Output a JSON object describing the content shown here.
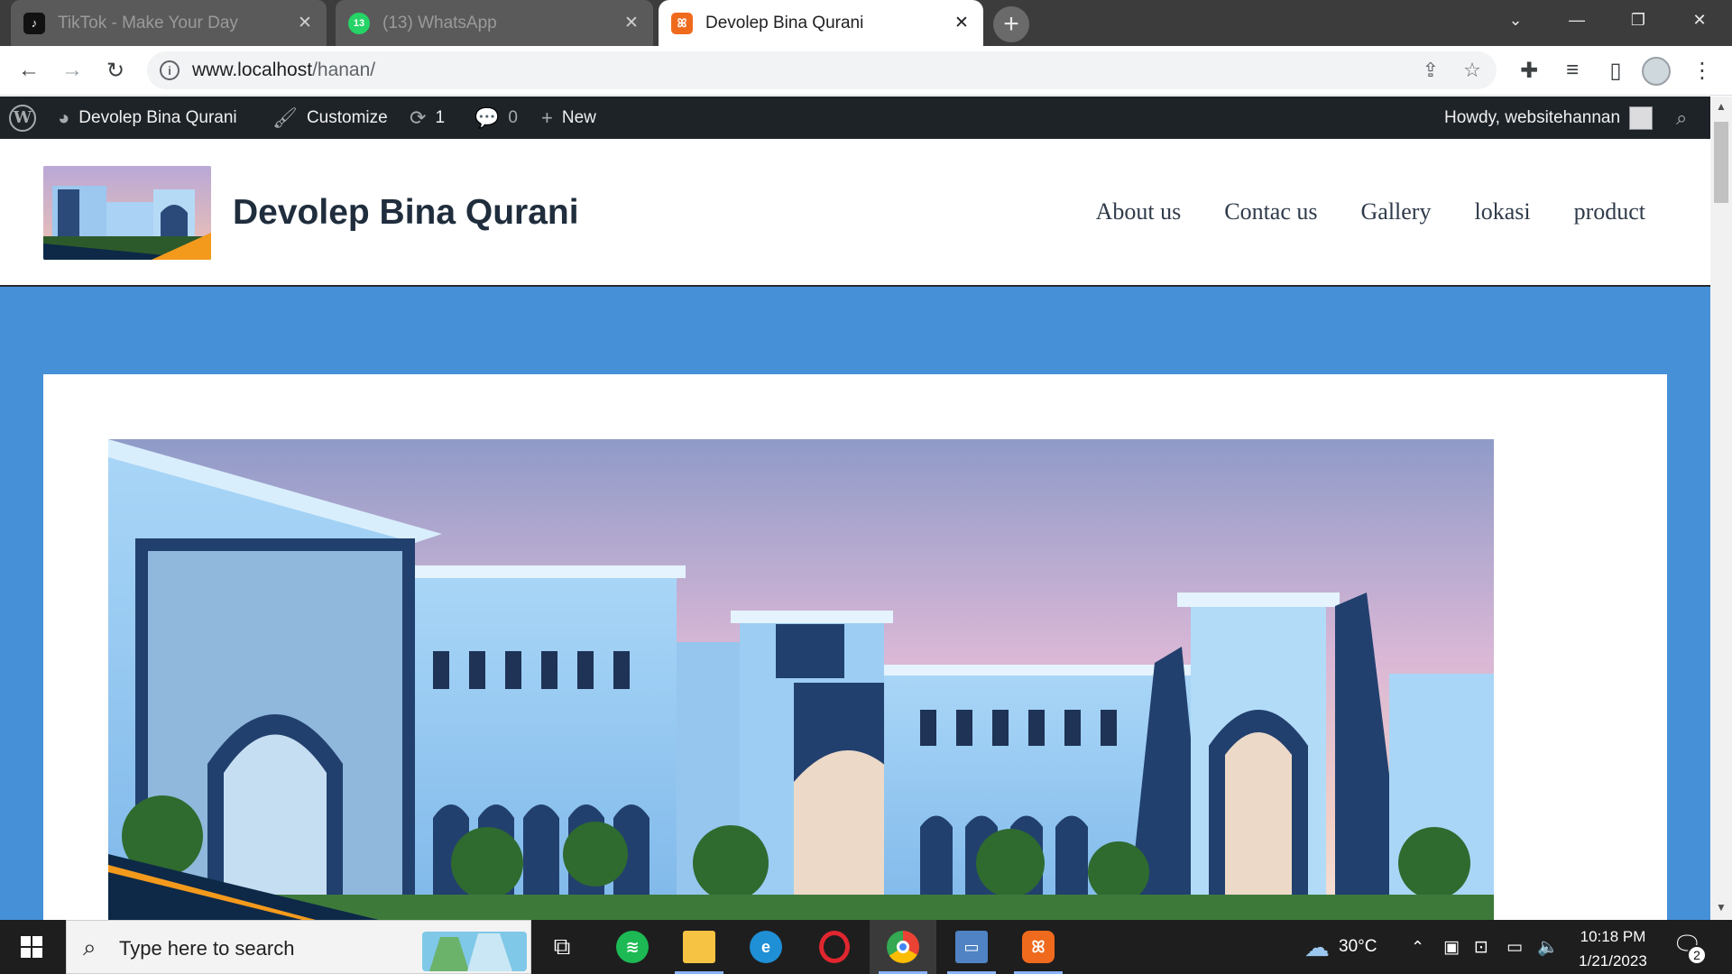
{
  "browser": {
    "tabs": [
      {
        "title": "TikTok - Make Your Day",
        "icon": "tiktok-icon",
        "active": false
      },
      {
        "title": "(13) WhatsApp",
        "icon": "whatsapp-icon",
        "badge": "13",
        "active": false
      },
      {
        "title": "Devolep Bina Qurani",
        "icon": "xampp-icon",
        "active": true
      }
    ],
    "url_host": "www.localhost",
    "url_path": "/hanan/"
  },
  "adminbar": {
    "site_name": "Devolep Bina Qurani",
    "customize": "Customize",
    "updates_count": "1",
    "comments_count": "0",
    "new_label": "New",
    "howdy": "Howdy, websitehannan"
  },
  "site": {
    "title": "Devolep Bina Qurani",
    "nav": [
      "About us",
      "Contac us",
      "Gallery",
      "lokasi",
      "product"
    ]
  },
  "taskbar": {
    "search_placeholder": "Type here to search",
    "weather": "30°C",
    "time": "10:18 PM",
    "date": "1/21/2023",
    "notification_count": "2"
  },
  "colors": {
    "content_background": "#4690d8",
    "adminbar": "#1d2327",
    "tab_strip": "#3c3c3c"
  }
}
